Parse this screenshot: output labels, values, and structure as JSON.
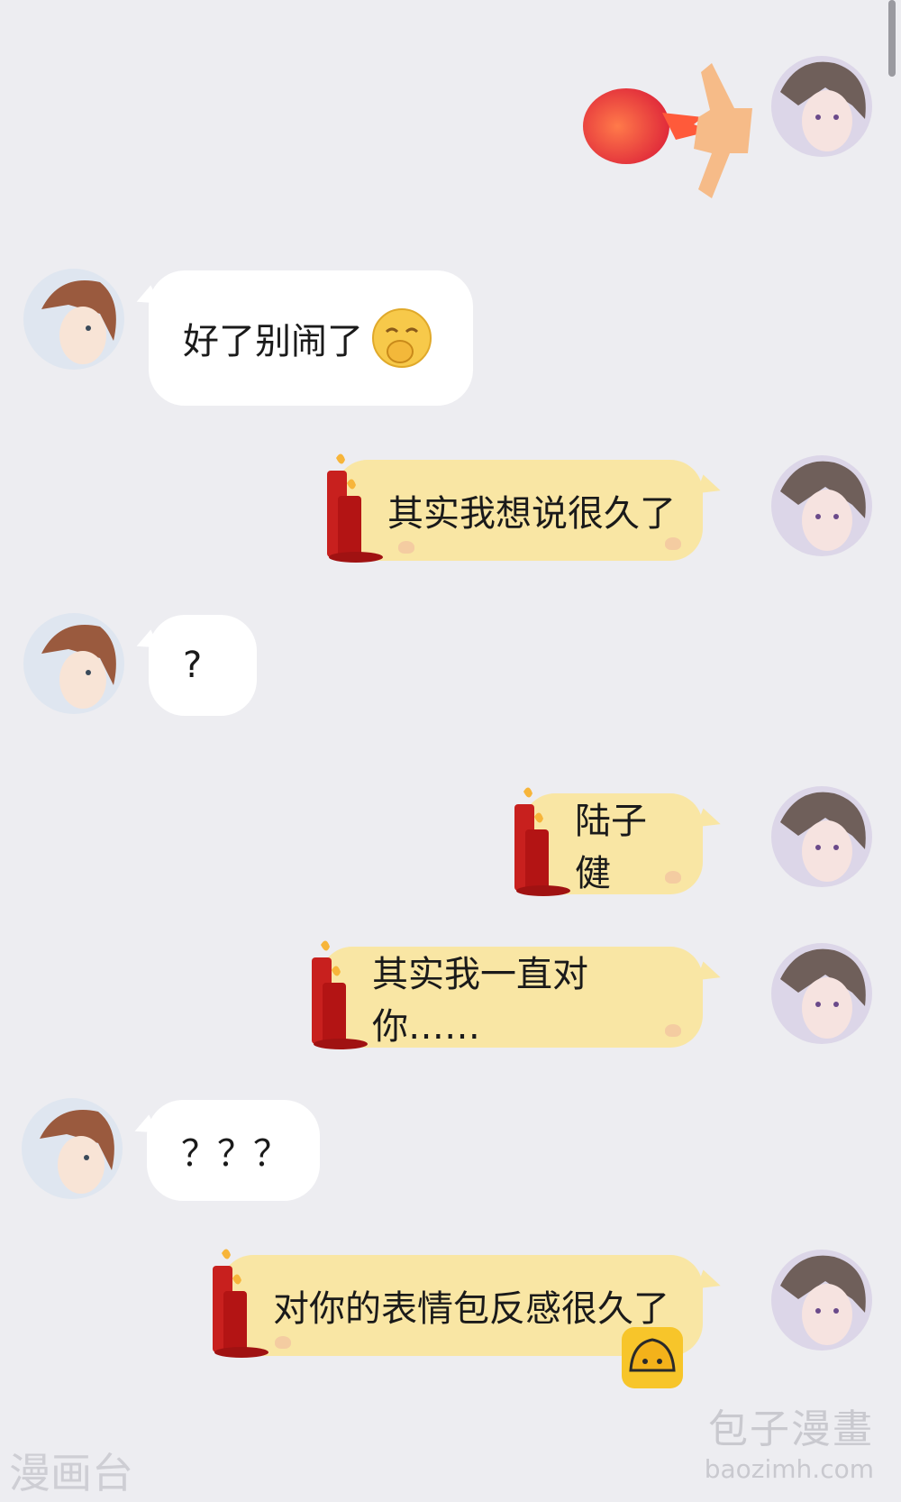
{
  "chat": {
    "messages": [
      {
        "side": "right",
        "type": "rocket-sticker"
      },
      {
        "side": "left",
        "text": "好了别闹了",
        "emoji": "embarrassed-smile"
      },
      {
        "side": "right",
        "text": "其实我想说很久了"
      },
      {
        "side": "left",
        "text": "?"
      },
      {
        "side": "right",
        "text": "陆子健"
      },
      {
        "side": "right",
        "text": "其实我一直对你……"
      },
      {
        "side": "left",
        "text": "？？？"
      },
      {
        "side": "right",
        "text": "对你的表情包反感很久了"
      }
    ]
  },
  "watermarks": {
    "left": "漫画台",
    "right_title": "包子漫畫",
    "right_url": "baozimh.com"
  },
  "colors": {
    "background": "#ededf1",
    "bubble_left": "#ffffff",
    "bubble_right": "#f9e6a4",
    "candle": "#c8201e"
  }
}
